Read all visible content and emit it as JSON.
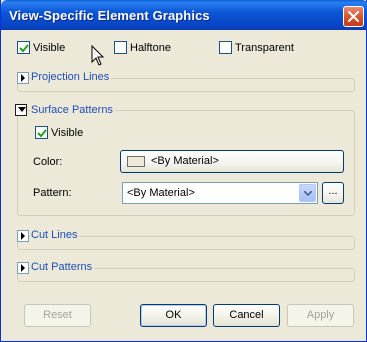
{
  "window": {
    "title": "View-Specific Element Graphics"
  },
  "top_options": {
    "visible": {
      "label": "Visible",
      "checked": true
    },
    "halftone": {
      "label": "Halftone",
      "checked": false
    },
    "transparent": {
      "label": "Transparent",
      "checked": false
    }
  },
  "sections": {
    "projection_lines": {
      "title": "Projection Lines",
      "expanded": false
    },
    "surface_patterns": {
      "title": "Surface Patterns",
      "expanded": true,
      "visible": {
        "label": "Visible",
        "checked": true
      },
      "color_label": "Color:",
      "color_value": "<By Material>",
      "pattern_label": "Pattern:",
      "pattern_value": "<By Material>",
      "browse_label": "..."
    },
    "cut_lines": {
      "title": "Cut Lines",
      "expanded": false
    },
    "cut_patterns": {
      "title": "Cut Patterns",
      "expanded": false
    }
  },
  "buttons": {
    "reset": "Reset",
    "ok": "OK",
    "cancel": "Cancel",
    "apply": "Apply"
  }
}
